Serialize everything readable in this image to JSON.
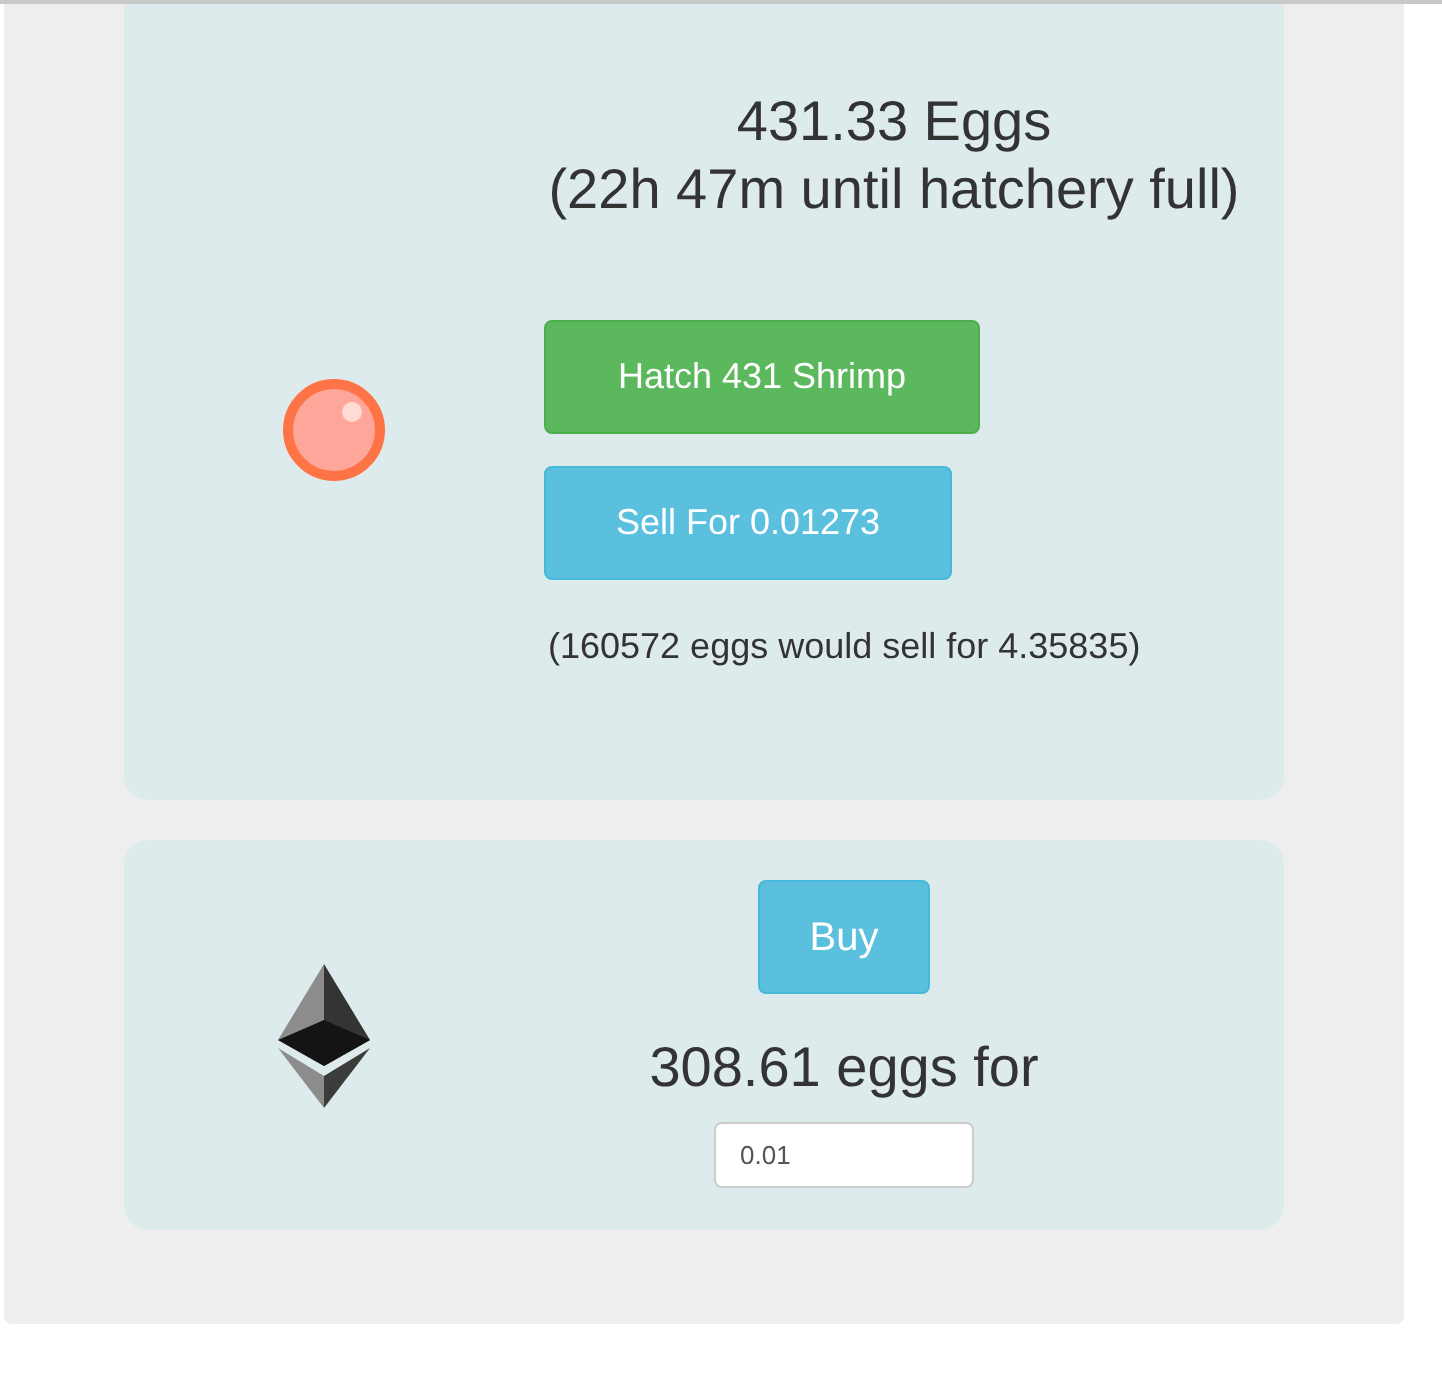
{
  "hatchery": {
    "eggs": "431.33 Eggs",
    "until_full": "(22h 47m until hatchery full)",
    "hatch_button": "Hatch 431 Shrimp",
    "sell_button": "Sell For 0.01273",
    "sell_note": "(160572 eggs would sell for 4.35835)"
  },
  "buy": {
    "button": "Buy",
    "eggs_for": "308.61 eggs for",
    "amount": {
      "value": "0.01"
    }
  }
}
